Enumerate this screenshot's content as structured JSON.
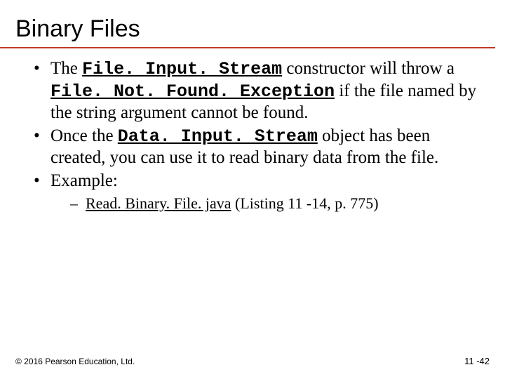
{
  "title": "Binary Files",
  "bullets": {
    "b1": {
      "pre": "The ",
      "code1": "File. Input. Stream",
      "mid1": " constructor will throw a ",
      "code2": "File. Not. Found. Exception",
      "post": " if the file named by the string argument cannot be found."
    },
    "b2": {
      "pre": "Once the ",
      "code1": "Data. Input. Stream",
      "post": " object has been created, you can use it to read binary data from the file."
    },
    "b3": {
      "text": "Example:"
    },
    "sub1": {
      "link": "Read. Binary. File. java",
      "rest": " (Listing 11 -14, p. 775)"
    }
  },
  "footer": {
    "copyright": "© 2016 Pearson Education, Ltd.",
    "pagenum": "11 -42"
  }
}
